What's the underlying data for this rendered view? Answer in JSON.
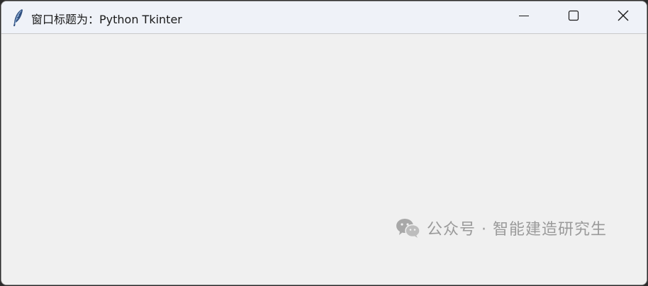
{
  "window": {
    "title": "窗口标题为：Python Tkinter",
    "app_icon": "feather-icon",
    "controls": {
      "minimize_icon": "minimize-icon",
      "maximize_icon": "maximize-icon",
      "close_icon": "close-icon"
    }
  },
  "watermark": {
    "icon": "wechat-icon",
    "text": "公众号 · 智能建造研究生"
  },
  "colors": {
    "titlebar_bg": "#eff2f8",
    "client_bg": "#f0f0f0",
    "watermark": "#9a9a9a"
  }
}
